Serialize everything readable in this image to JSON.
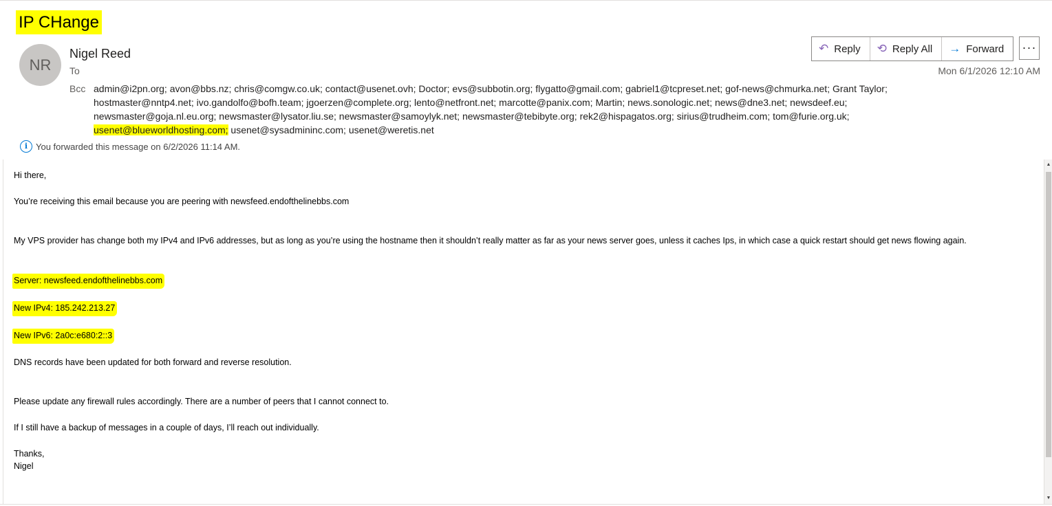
{
  "subject": "IP CHange",
  "sender": {
    "initials": "NR",
    "name": "Nigel Reed",
    "to_label": "To",
    "bcc_label": "Bcc",
    "date": "Mon 6/1/2026 12:10 AM"
  },
  "bcc_rows": [
    "admin@i2pn.org; avon@bbs.nz; chris@comgw.co.uk; contact@usenet.ovh; Doctor; evs@subbotin.org; flygatto@gmail.com; gabriel1@tcpreset.net; gof-news@chmurka.net; Grant Taylor;",
    "hostmaster@nntp4.net; ivo.gandolfo@bofh.team; jgoerzen@complete.org; lento@netfront.net; marcotte@panix.com; Martin; news.sonologic.net; news@dne3.net; newsdeef.eu;",
    "newsmaster@goja.nl.eu.org; newsmaster@lysator.liu.se; newsmaster@samoylyk.net; newsmaster@tebibyte.org; rek2@hispagatos.org; sirius@trudheim.com; tom@furie.org.uk;"
  ],
  "bcc_last_row": {
    "highlighted": "usenet@blueworldhosting.com;",
    "rest": " usenet@sysadmininc.com; usenet@weretis.net"
  },
  "actions": {
    "reply": "Reply",
    "reply_all": "Reply All",
    "forward": "Forward",
    "more": "···"
  },
  "info": "You forwarded this message on 6/2/2026 11:14 AM.",
  "body": {
    "greeting": "Hi there,",
    "p1": "You’re receiving this email because you are peering with newsfeed.endofthelinebbs.com",
    "p2": "My VPS provider has change both my IPv4 and IPv6 addresses, but as long as you’re using the hostname then it shouldn’t really matter as far as your news server goes, unless it caches Ips, in which case a quick restart should get news flowing again.",
    "server": "Server: newsfeed.endofthelinebbs.com",
    "ipv4": "New IPv4: 185.242.213.27",
    "ipv6": "New IPv6: 2a0c:e680:2::3",
    "p3": "DNS records have been updated for both forward and reverse resolution.",
    "p4": "Please update any firewall rules accordingly. There are a number of peers that I cannot connect to.",
    "p5": "If I still have a backup of messages in a couple of days, I’ll reach out individually.",
    "closing": "Thanks,",
    "signature": "Nigel"
  },
  "colors": {
    "highlight": "#ffff00",
    "reply_icon": "#8764b8",
    "forward_icon": "#0078d4",
    "info_icon": "#0078d4"
  }
}
